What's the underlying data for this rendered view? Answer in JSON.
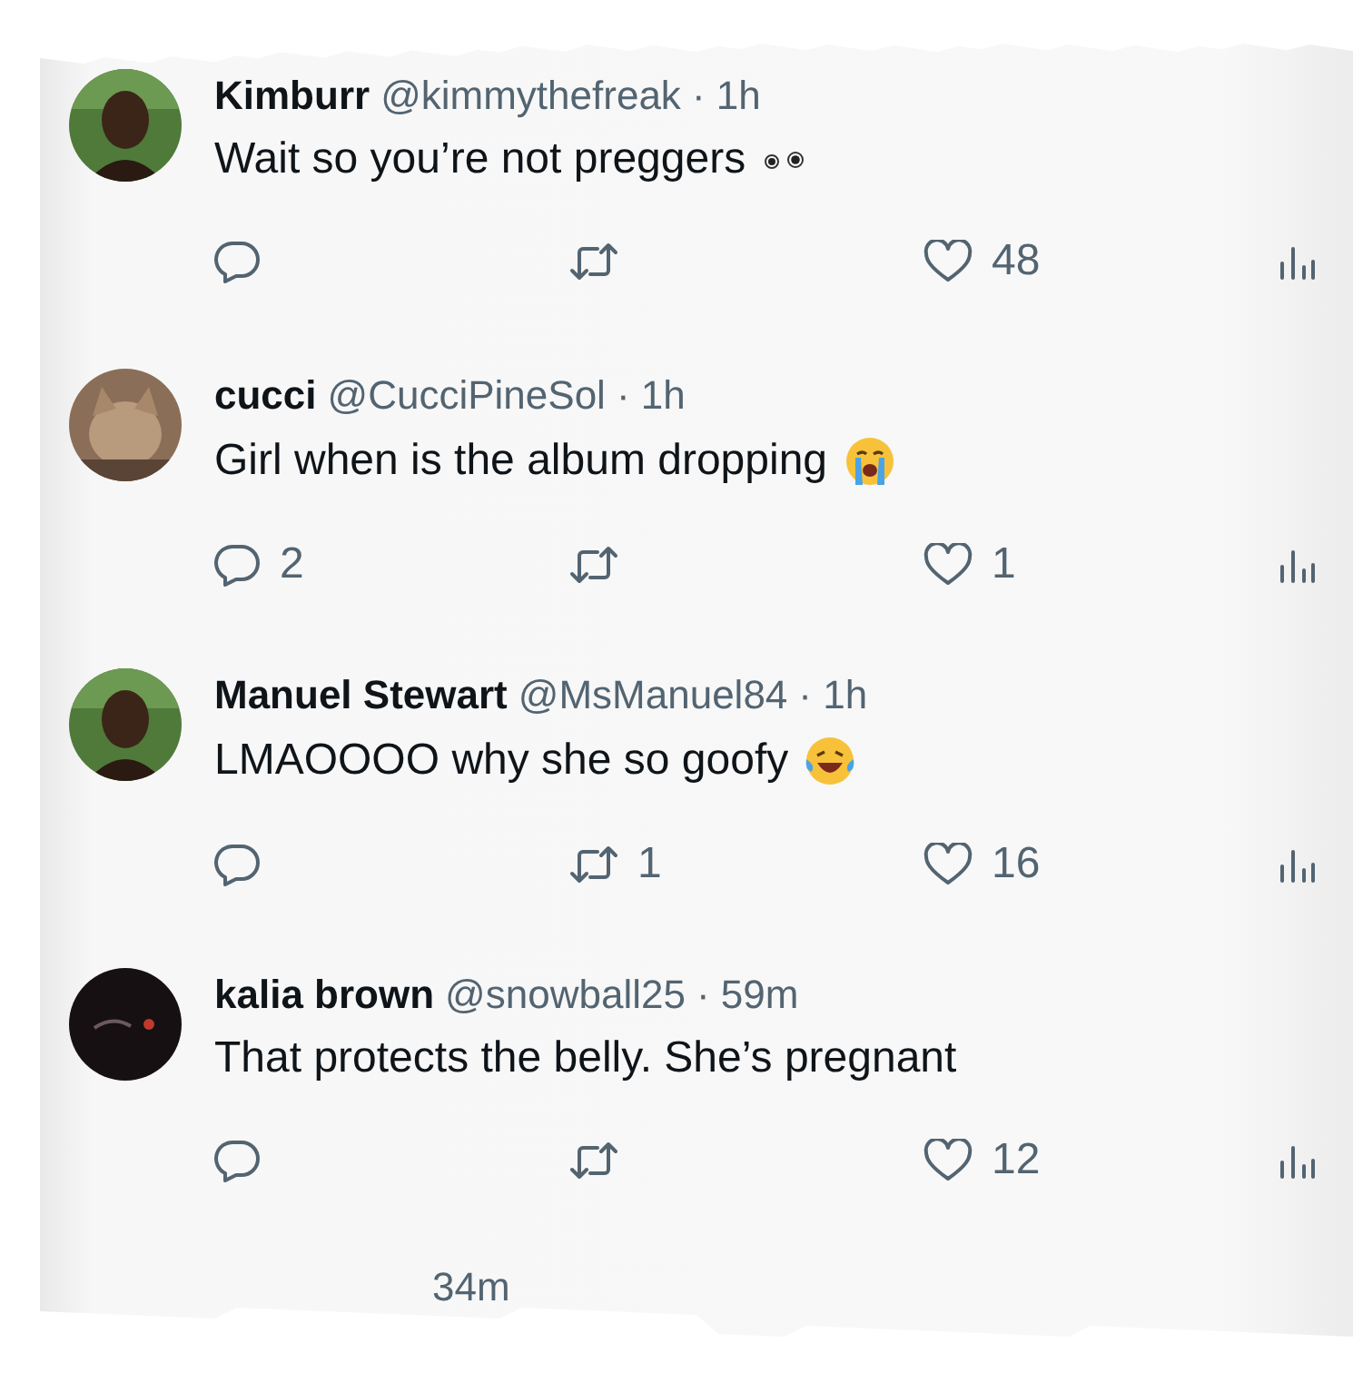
{
  "replies": [
    {
      "name": "Kimburr",
      "handle": "@kimmythefreak",
      "time": "· 1h",
      "text": "Wait so you’re not preggers",
      "emoji": {
        "kind": "eyes"
      },
      "likes": "48"
    },
    {
      "name": "cucci",
      "handle": "@CucciPineSol",
      "time": "· 1h",
      "text": "Girl when is the album dropping",
      "emoji": {
        "kind": "crying"
      },
      "replies": "2",
      "likes": "1"
    },
    {
      "name": "Manuel Stewart",
      "handle": "@MsManuel84",
      "time": "· 1h",
      "text": "LMAOOOO why she so goofy",
      "emoji": {
        "kind": "laughing"
      },
      "retweets": "1",
      "likes": "16"
    },
    {
      "name": "kalia brown",
      "handle": "@snowball25",
      "time": "· 59m",
      "text": "That protects the belly. She’s pregnant",
      "likes": "12"
    }
  ],
  "cut_reply": {
    "time": "34m"
  }
}
